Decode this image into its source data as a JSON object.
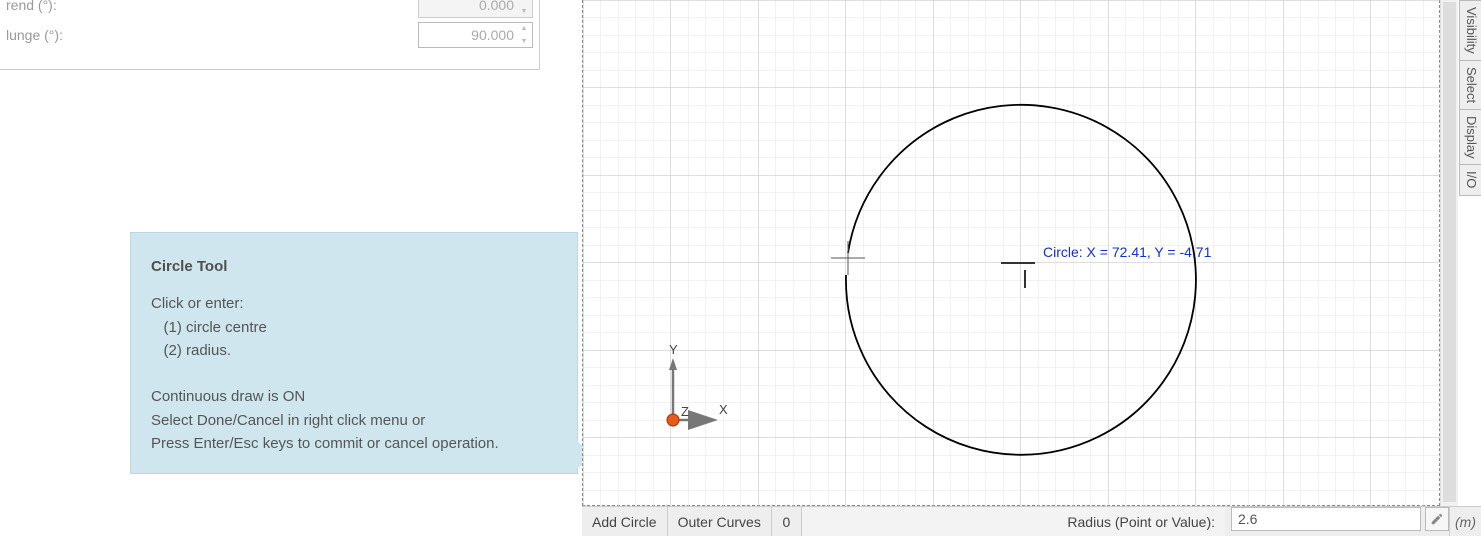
{
  "props": {
    "trend": {
      "label": "rend (°):",
      "value": "0.000"
    },
    "plunge": {
      "label": "lunge (°):",
      "value": "90.000"
    }
  },
  "tooltip": {
    "title": "Circle Tool",
    "line1": "Click or enter:",
    "line2": "   (1) circle centre",
    "line3": "   (2) radius.",
    "line4": "Continuous draw is ON",
    "line5": "Select Done/Cancel in right click menu or",
    "line6": "Press Enter/Esc keys to commit or cancel operation."
  },
  "canvas": {
    "cursor_label": "Circle: X = 72.41, Y = -4.71",
    "axes": {
      "x": "X",
      "y": "Y",
      "z": "Z"
    }
  },
  "status": {
    "mode": "Add Circle",
    "layer": "Outer Curves",
    "count": "0",
    "radius_label": "Radius (Point or Value):",
    "radius_value": "2.6",
    "unit": "(m)"
  },
  "side_tabs": [
    "Visibility",
    "Select",
    "Display",
    "I/O"
  ]
}
